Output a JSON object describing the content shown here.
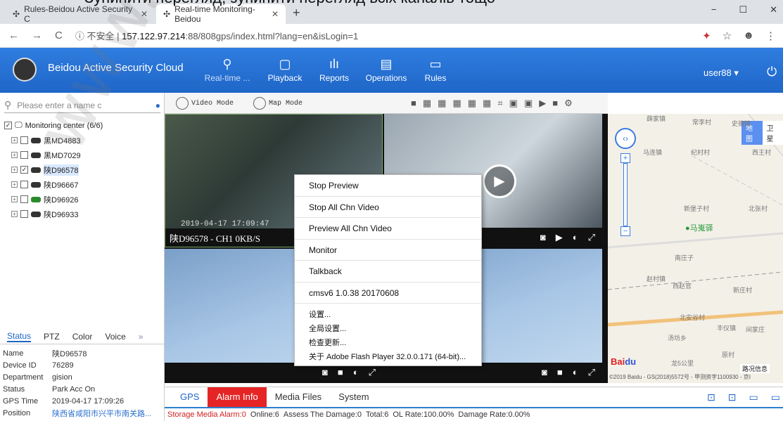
{
  "caption": "Зупинити перегляд, зупинити  перегляд всіх каналів тощо",
  "browser": {
    "tabs": [
      {
        "title": "Rules-Beidou Active Security C"
      },
      {
        "title": "Real-time Monitoring-Beidou"
      }
    ],
    "new_tab": "+",
    "insecure": "不安全",
    "url_host": "157.122.97.214",
    "url_rest": ":88/808gps/index.html?lang=en&isLogin=1",
    "win": [
      "−",
      "☐",
      "✕"
    ]
  },
  "app": {
    "title": "Beidou Active Security Cloud",
    "nav": [
      {
        "label": "Real-time ...",
        "icon": "location-pin-icon"
      },
      {
        "label": "Playback",
        "icon": "playback-icon"
      },
      {
        "label": "Reports",
        "icon": "chart-icon"
      },
      {
        "label": "Operations",
        "icon": "operations-icon"
      },
      {
        "label": "Rules",
        "icon": "rules-icon"
      }
    ],
    "user": "user88 ▾",
    "power": "⏻"
  },
  "sidebar": {
    "search_placeholder": "Please enter a name c",
    "root": "Monitoring center  (6/6)",
    "vehicles": [
      {
        "name": "黑MD4883",
        "checked": false
      },
      {
        "name": "黑MD7029",
        "checked": false
      },
      {
        "name": "陕D96578",
        "checked": true
      },
      {
        "name": "陕D96667",
        "checked": false
      },
      {
        "name": "陕D96926",
        "checked": false
      },
      {
        "name": "陕D96933",
        "checked": false
      }
    ],
    "tabs": [
      "Status",
      "PTZ",
      "Color",
      "Voice",
      "»"
    ],
    "info": [
      {
        "k": "Name",
        "v": "陕D96578"
      },
      {
        "k": "Device ID",
        "v": "76289"
      },
      {
        "k": "Department",
        "v": "gision"
      },
      {
        "k": "Status",
        "v": "Park Acc On"
      },
      {
        "k": "GPS Time",
        "v": "2019-04-17 17:09:26"
      },
      {
        "k": "Position",
        "v": "陕西省咸阳市兴平市南关路..."
      }
    ]
  },
  "toolbar": {
    "video_mode": "Video Mode",
    "map_mode": "Map Mode"
  },
  "video": {
    "cell1_label": "陕D96578 - CH1 0KB/S",
    "timestamp": "2019-04-17 17:09:47"
  },
  "context_menu": {
    "main": [
      "Stop Preview",
      "Stop All Chn Video",
      "Preview All Chn Video",
      "Monitor",
      "Talkback",
      "cmsv6 1.0.38 20170608"
    ],
    "flash": [
      "设置...",
      "全局设置...",
      "检查更新...",
      "关于 Adobe Flash Player 32.0.0.171 (64-bit)..."
    ]
  },
  "map": {
    "labels": [
      "薛家镇",
      "常李村",
      "史德镇",
      "马连镇",
      "纪村村",
      "西王村",
      "新堡子村",
      "北张村",
      "马嵬驿",
      "南庄子",
      "赵村镇",
      "西赵官",
      "新庄村",
      "北安谷村",
      "丰仪镇",
      "间家庄",
      "汤坊乡",
      "原村",
      "龙5公里"
    ],
    "map_btn": "地图",
    "sat_btn": "卫星",
    "copyright": "©2019 Baidu - GS(2018)5572号 - 甲测资字1100930 - 京I",
    "traffic": "路况信息"
  },
  "bottom": {
    "tabs": [
      "GPS",
      "Alarm Info",
      "Media Files",
      "System"
    ],
    "status": [
      {
        "t": "Storage Media Alarm:0",
        "red": true
      },
      {
        "t": "Online:6",
        "red": false
      },
      {
        "t": "Assess The Damage:0",
        "red": false
      },
      {
        "t": "Total:6",
        "red": false
      },
      {
        "t": "OL Rate:100.00%",
        "red": false
      },
      {
        "t": "Damage Rate:0.00%",
        "red": false
      }
    ]
  },
  "watermark": "www.bee"
}
